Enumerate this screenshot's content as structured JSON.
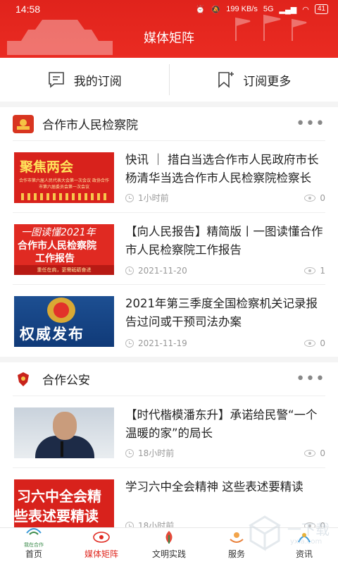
{
  "status_bar": {
    "time": "14:58",
    "net_speed": "199 KB/s",
    "net_type": "5G",
    "battery": "41"
  },
  "header": {
    "title": "媒体矩阵"
  },
  "subscribe_bar": {
    "my_subscriptions": "我的订阅",
    "subscribe_more": "订阅更多"
  },
  "sections": [
    {
      "name": "合作市人民检察院",
      "logo_icon": "procuratorate-logo-icon",
      "articles": [
        {
          "title": "快讯 ｜ 措白当选合作市人民政府市长 杨清华当选合作市人民检察院检察长",
          "time": "1小时前",
          "views": "0",
          "thumb": {
            "headline": "聚焦两会",
            "caption": "合作市第六届人民代表大会第一次会议 政协合作市第六届委员会第一次会议"
          }
        },
        {
          "title": "【向人民报告】精简版丨一图读懂合作市人民检察院工作报告",
          "time": "2021-11-20",
          "views": "1",
          "thumb": {
            "line1": "一图读懂2021年",
            "line2": "合作市人民检察院",
            "line3": "工作报告",
            "band": "重任在肩，更需砥砺奋进"
          }
        },
        {
          "title": "2021年第三季度全国检察机关记录报告过问或干预司法办案",
          "time": "2021-11-19",
          "views": "0",
          "thumb": {
            "text": "权威发布"
          }
        }
      ]
    },
    {
      "name": "合作公安",
      "logo_icon": "police-logo-icon",
      "articles": [
        {
          "title": "【时代楷模潘东升】承诺给民警“一个温暖的家”的局长",
          "time": "18小时前",
          "views": "0",
          "thumb": {
            "kind": "photo"
          }
        },
        {
          "title": "学习六中全会精神 这些表述要精读",
          "time": "18小时前",
          "views": "0",
          "thumb": {
            "line1": "习六中全会精",
            "line2": "些表述要精读"
          }
        }
      ]
    }
  ],
  "bottom_nav": {
    "items": [
      {
        "label": "首页",
        "sub": "我在合作",
        "icon": "home-logo-icon",
        "active": false
      },
      {
        "label": "媒体矩阵",
        "icon": "media-matrix-icon",
        "active": true
      },
      {
        "label": "文明实践",
        "icon": "civilization-practice-icon",
        "active": false
      },
      {
        "label": "服务",
        "icon": "service-icon",
        "active": false
      },
      {
        "label": "资讯",
        "icon": "news-icon",
        "active": false
      }
    ]
  },
  "watermark": {
    "text": "一下载",
    "domain": "yxia.com"
  },
  "colors": {
    "brand_red": "#e02a22",
    "text": "#222222",
    "meta": "#999999"
  }
}
